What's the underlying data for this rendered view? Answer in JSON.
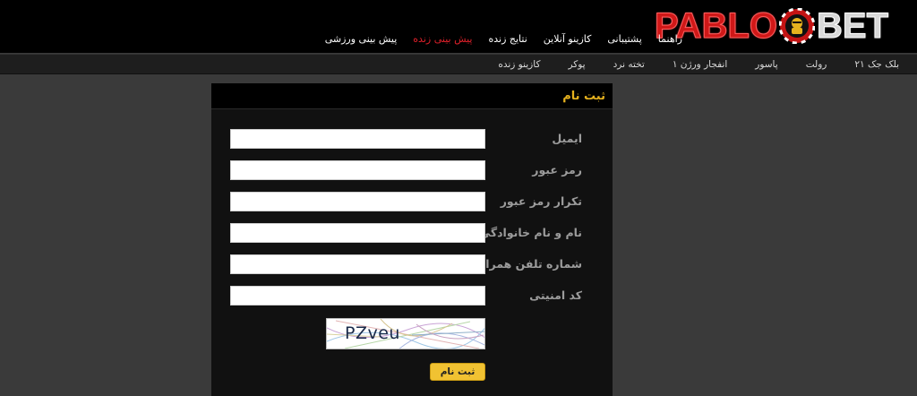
{
  "brand": {
    "logo_left": "PABLO",
    "logo_right": "BET",
    "red": "#d01818",
    "gold": "#e6b21e"
  },
  "main_nav": [
    {
      "label": "پیش بینی ورزشی",
      "active": false
    },
    {
      "label": "پیش بینی زنده",
      "active": true
    },
    {
      "label": "نتایج زنده",
      "active": false
    },
    {
      "label": "کازینو آنلاین",
      "active": false
    },
    {
      "label": "پشتیبانی",
      "active": false
    },
    {
      "label": "راهنما",
      "active": false
    }
  ],
  "sub_nav": [
    "کازینو زنده",
    "پوکر",
    "تخته نرد",
    "انفجار ورژن ۱",
    "پاسور",
    "رولت",
    "بلک جک ۲۱"
  ],
  "form": {
    "title": "ثبت نام",
    "fields": [
      {
        "label": "ایمیل",
        "value": "",
        "placeholder": ""
      },
      {
        "label": "رمز عبور",
        "value": "",
        "placeholder": ""
      },
      {
        "label": "تکرار رمز عبور",
        "value": "",
        "placeholder": ""
      },
      {
        "label": "نام و نام خانوادگی",
        "value": "",
        "placeholder": ""
      },
      {
        "label": "شماره تلفن همراه",
        "value": "",
        "placeholder": ""
      },
      {
        "label": "کد امنیتی",
        "value": "",
        "placeholder": ""
      }
    ],
    "captcha_text": "PZveu",
    "submit_label": "ثبت نام"
  }
}
